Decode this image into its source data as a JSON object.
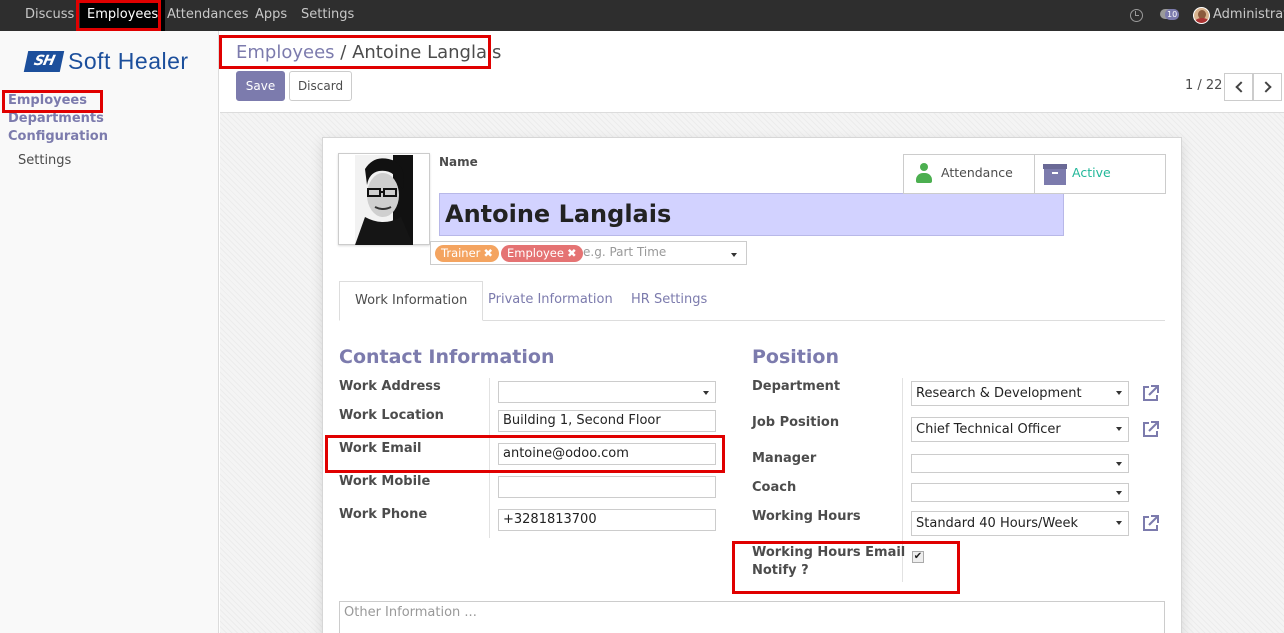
{
  "topnav": {
    "menu": [
      "Discuss",
      "Employees",
      "Attendances",
      "Apps",
      "Settings"
    ],
    "active": "Employees",
    "message_count": "10",
    "user": "Administrator"
  },
  "sidebar": {
    "logo_mark": "SH",
    "logo_text": "Soft Healer",
    "items": [
      "Employees",
      "Departments",
      "Configuration"
    ],
    "sub_items": [
      "Settings"
    ]
  },
  "breadcrumb": {
    "parent": "Employees",
    "separator": "/",
    "current": "Antoine Langlais"
  },
  "buttons": {
    "save": "Save",
    "discard": "Discard"
  },
  "pager": {
    "value": "1 / 22"
  },
  "smart_buttons": {
    "attendance": "Attendance",
    "active": "Active"
  },
  "employee": {
    "name_label": "Name",
    "name": "Antoine Langlais",
    "tags": [
      "Trainer",
      "Employee"
    ],
    "tags_placeholder": "e.g. Part Time"
  },
  "tabs": [
    "Work Information",
    "Private Information",
    "HR Settings"
  ],
  "contact": {
    "title": "Contact Information",
    "labels": {
      "work_address": "Work Address",
      "work_location": "Work Location",
      "work_email": "Work Email",
      "work_mobile": "Work Mobile",
      "work_phone": "Work Phone"
    },
    "values": {
      "work_address": "",
      "work_location": "Building 1, Second Floor",
      "work_email": "antoine@odoo.com",
      "work_mobile": "",
      "work_phone": "+3281813700"
    }
  },
  "position": {
    "title": "Position",
    "labels": {
      "department": "Department",
      "job_position": "Job Position",
      "manager": "Manager",
      "coach": "Coach",
      "working_hours": "Working Hours",
      "notify_line1": "Working Hours Email",
      "notify_line2": "Notify ?"
    },
    "values": {
      "department": "Research & Development",
      "job_position": "Chief Technical Officer",
      "manager": "",
      "coach": "",
      "working_hours": "Standard 40 Hours/Week",
      "notify_checked": true,
      "notify_mark": "✔"
    }
  },
  "notes": {
    "placeholder": "Other Information ..."
  },
  "colors": {
    "accent": "#7c7bad",
    "highlight": "#e00000",
    "name_field_bg": "#d2d2ff",
    "active_green": "#21b799"
  }
}
